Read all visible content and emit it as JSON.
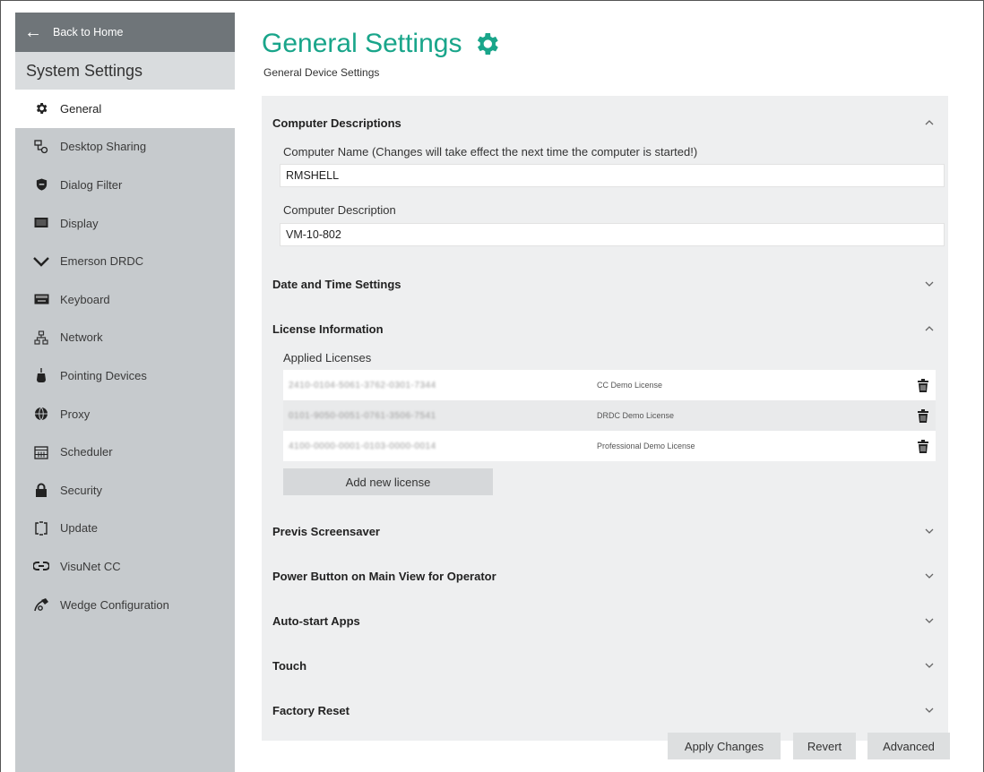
{
  "sidebar": {
    "back_label": "Back to Home",
    "title": "System Settings",
    "items": [
      {
        "label": "General",
        "icon": "gear-icon"
      },
      {
        "label": "Desktop Sharing",
        "icon": "desktop-sharing-icon"
      },
      {
        "label": "Dialog Filter",
        "icon": "shield-icon"
      },
      {
        "label": "Display",
        "icon": "display-icon"
      },
      {
        "label": "Emerson DRDC",
        "icon": "chevron-down-icon"
      },
      {
        "label": "Keyboard",
        "icon": "keyboard-icon"
      },
      {
        "label": "Network",
        "icon": "network-icon"
      },
      {
        "label": "Pointing Devices",
        "icon": "mouse-icon"
      },
      {
        "label": "Proxy",
        "icon": "globe-icon"
      },
      {
        "label": "Scheduler",
        "icon": "calendar-icon"
      },
      {
        "label": "Security",
        "icon": "lock-icon"
      },
      {
        "label": "Update",
        "icon": "update-icon"
      },
      {
        "label": "VisuNet CC",
        "icon": "link-icon"
      },
      {
        "label": "Wedge Configuration",
        "icon": "wedge-icon"
      }
    ]
  },
  "header": {
    "title": "General Settings",
    "subtitle": "General Device Settings"
  },
  "sections": {
    "computer": {
      "title": "Computer Descriptions",
      "name_label": "Computer Name (Changes will take effect the next time the computer is started!)",
      "name_value": "RMSHELL",
      "desc_label": "Computer Description",
      "desc_value": "VM-10-802"
    },
    "datetime": {
      "title": "Date and Time Settings"
    },
    "license": {
      "title": "License Information",
      "applied_label": "Applied Licenses",
      "licenses": [
        {
          "key": "2410-0104-5061-3762-0301-7344",
          "name": "CC Demo License"
        },
        {
          "key": "0101-9050-0051-0761-3506-7541",
          "name": "DRDC Demo License"
        },
        {
          "key": "4100-0000-0001-0103-0000-0014",
          "name": "Professional Demo License"
        }
      ],
      "add_label": "Add new license"
    },
    "previs": {
      "title": "Previs Screensaver"
    },
    "power": {
      "title": "Power Button on Main View for Operator"
    },
    "autostart": {
      "title": "Auto-start Apps"
    },
    "touch": {
      "title": "Touch"
    },
    "factory": {
      "title": "Factory Reset"
    }
  },
  "footer": {
    "apply_label": "Apply Changes",
    "revert_label": "Revert",
    "advanced_label": "Advanced"
  },
  "colors": {
    "accent": "#19a58a",
    "sidebar_bg": "#c6cacd",
    "back_bg": "#6f7579",
    "panel_bg": "#eeeff0"
  }
}
